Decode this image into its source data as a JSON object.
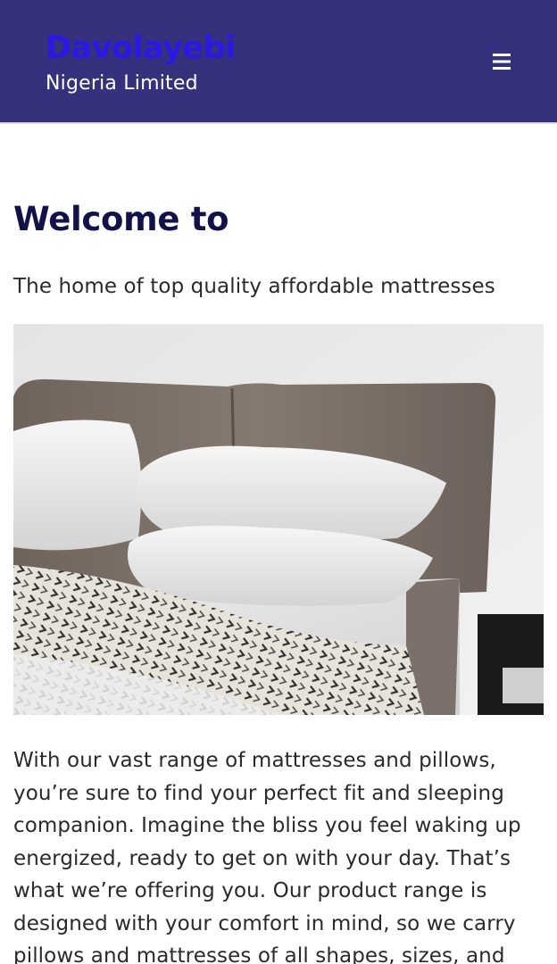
{
  "header": {
    "brand_name": "Davolayebi",
    "brand_subtitle": "Nigeria Limited",
    "menu_icon": "hamburger-menu-icon",
    "background_color": "#35317c",
    "brand_color": "#2a18e6"
  },
  "main": {
    "welcome_title": "Welcome to",
    "tagline": "The home of top quality affordable mattresses",
    "hero_image_alt": "bed-with-pillows-image",
    "intro_text": "With our vast range of mattresses and pillows, you’re sure to find your perfect fit and sleeping companion. Imagine the bliss you feel waking up energized, ready to get on with your day. That’s what we’re offering you. Our product range is designed with your comfort in mind, so we carry pillows and mattresses of all shapes, sizes, and"
  }
}
